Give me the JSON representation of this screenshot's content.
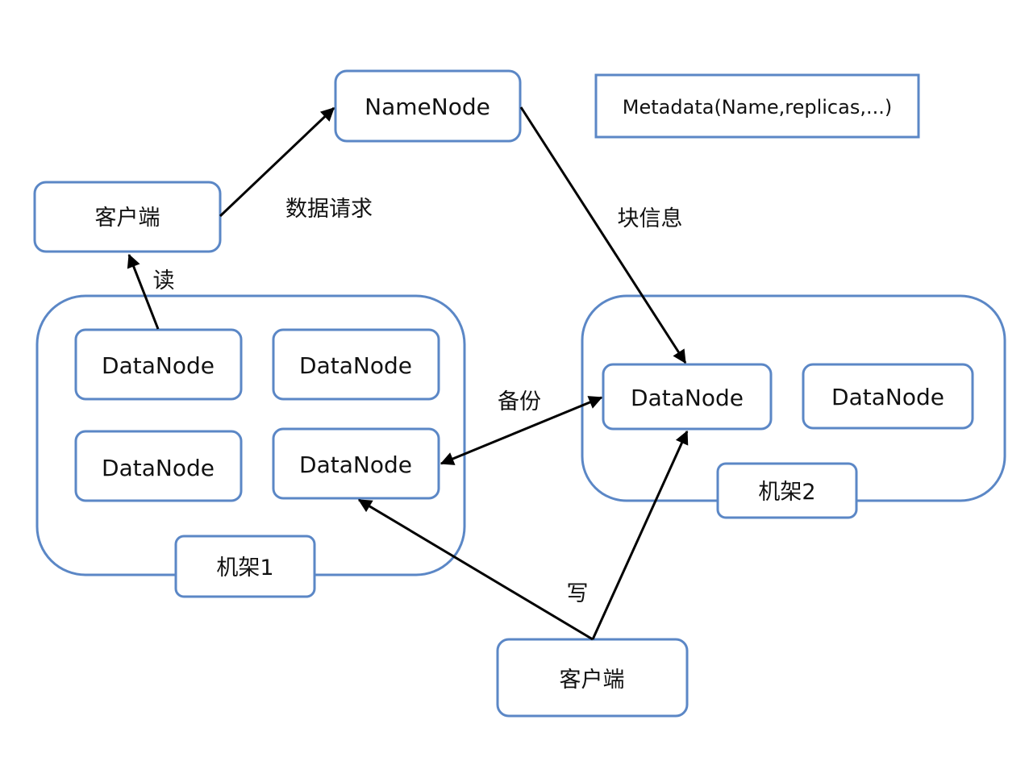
{
  "colors": {
    "box_stroke": "#5b87c6",
    "arrow": "#000000"
  },
  "namenode": "NameNode",
  "metadata": "Metadata(Name,replicas,...)",
  "client_top": "客户端",
  "client_bottom": "客户端",
  "rack1": {
    "label": "机架1",
    "datanodes": [
      "DataNode",
      "DataNode",
      "DataNode",
      "DataNode"
    ]
  },
  "rack2": {
    "label": "机架2",
    "datanodes": [
      "DataNode",
      "DataNode"
    ]
  },
  "edge_labels": {
    "data_request": "数据请求",
    "block_info": "块信息",
    "read": "读",
    "backup": "备份",
    "write": "写"
  }
}
